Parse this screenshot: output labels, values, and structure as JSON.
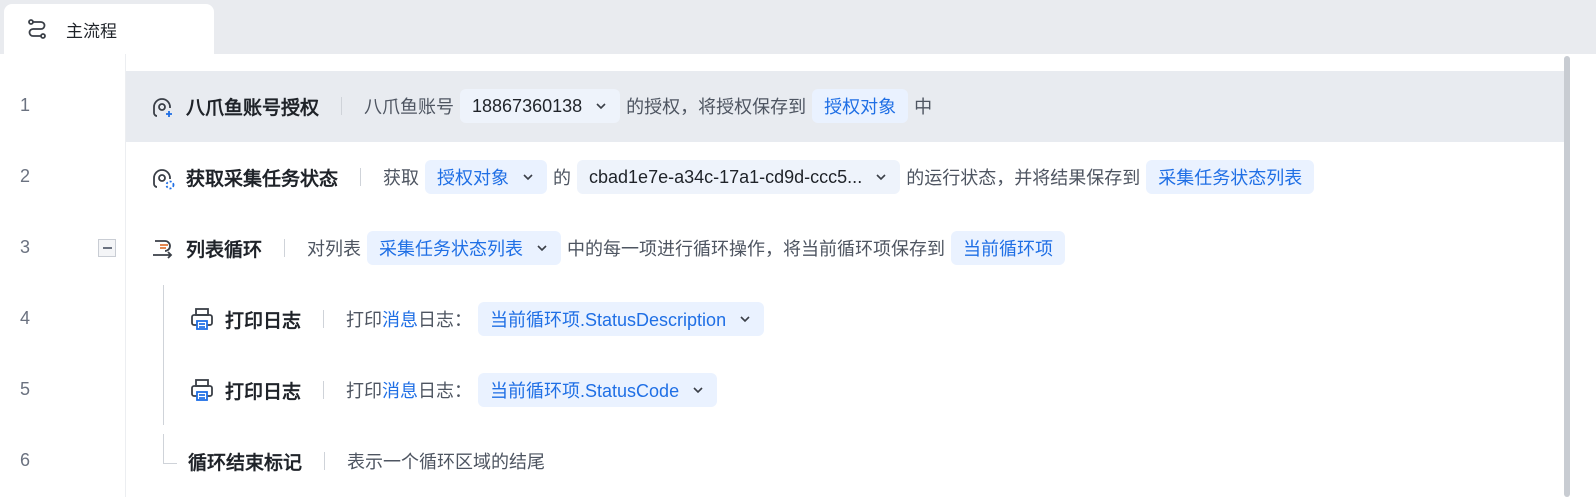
{
  "tab": {
    "label": "主流程",
    "icon": "flow-icon"
  },
  "rows": [
    {
      "line": "1",
      "icon": "account-auth-icon",
      "title": "八爪鱼账号授权",
      "t1": "八爪鱼账号",
      "v1": "18867360138",
      "t2": "的授权，将授权保存到",
      "v2": "授权对象",
      "t3": "中"
    },
    {
      "line": "2",
      "icon": "task-status-icon",
      "title": "获取采集任务状态",
      "t1": "获取",
      "v1": "授权对象",
      "t2": "的",
      "v2": "cbad1e7e-a34c-17a1-cd9d-ccc5...",
      "t3": "的运行状态，并将结果保存到",
      "v3": "采集任务状态列表"
    },
    {
      "line": "3",
      "icon": "list-loop-icon",
      "title": "列表循环",
      "t1": "对列表",
      "v1": "采集任务状态列表",
      "t2": "中的每一项进行循环操作，将当前循环项保存到",
      "v2": "当前循环项"
    },
    {
      "line": "4",
      "icon": "printer-icon",
      "title": "打印日志",
      "t1": "打印",
      "t1b": "消息",
      "t1c": "日志：",
      "v1": "当前循环项.StatusDescription"
    },
    {
      "line": "5",
      "icon": "printer-icon",
      "title": "打印日志",
      "t1": "打印",
      "t1b": "消息",
      "t1c": "日志：",
      "v1": "当前循环项.StatusCode"
    },
    {
      "line": "6",
      "title": "循环结束标记",
      "t1": "表示一个循环区域的结尾"
    }
  ],
  "colors": {
    "accent": "#1f6fe5",
    "chip_bg": "#eaf2ff",
    "highlight_row": "#e8ebf0"
  }
}
